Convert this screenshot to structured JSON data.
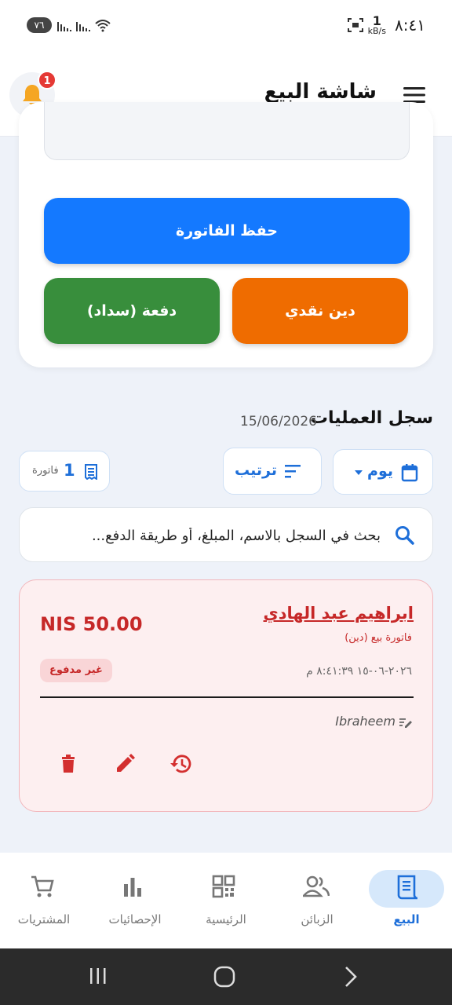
{
  "status_bar": {
    "time": "٨:٤١",
    "net_speed_value": "1",
    "net_speed_unit": "kB/s",
    "battery": "٧٦"
  },
  "app_bar": {
    "title": "شاشة البيع",
    "notification_count": "1"
  },
  "actions": {
    "save_invoice": "حفظ الفاتورة",
    "cash_debt": "دين نقدي",
    "payment": "دفعة (سداد)"
  },
  "log": {
    "title": "سجل العمليات",
    "date": "15/06/2026"
  },
  "filters": {
    "day": "يوم",
    "sort": "ترتيب",
    "invoice_count": "1",
    "invoice_label": "فاتورة"
  },
  "search": {
    "placeholder": "بحث في السجل بالاسم، المبلغ، أو طريقة الدفع..."
  },
  "invoice": {
    "customer": "ابراهيم عبد الهادي",
    "type": "فاتورة بيع (دين)",
    "datetime": "٢٠٢٦-٠٦-١٥ ٨:٤١:٣٩ م",
    "amount": "NIS 50.00",
    "status": "غير مدفوع",
    "user": "Ibraheem"
  },
  "bottom_nav": {
    "items": [
      {
        "label": "البيع",
        "icon": "receipt-icon",
        "active": true
      },
      {
        "label": "الزبائن",
        "icon": "people-icon",
        "active": false
      },
      {
        "label": "الرئيسية",
        "icon": "dashboard-icon",
        "active": false
      },
      {
        "label": "الإحصائيات",
        "icon": "bar-chart-icon",
        "active": false
      },
      {
        "label": "المشتريات",
        "icon": "cart-icon",
        "active": false
      }
    ]
  },
  "colors": {
    "primary": "#1479ff",
    "orange": "#ef6c00",
    "green": "#388e3c",
    "danger": "#c62828",
    "active_nav": "#d6e8fb"
  }
}
